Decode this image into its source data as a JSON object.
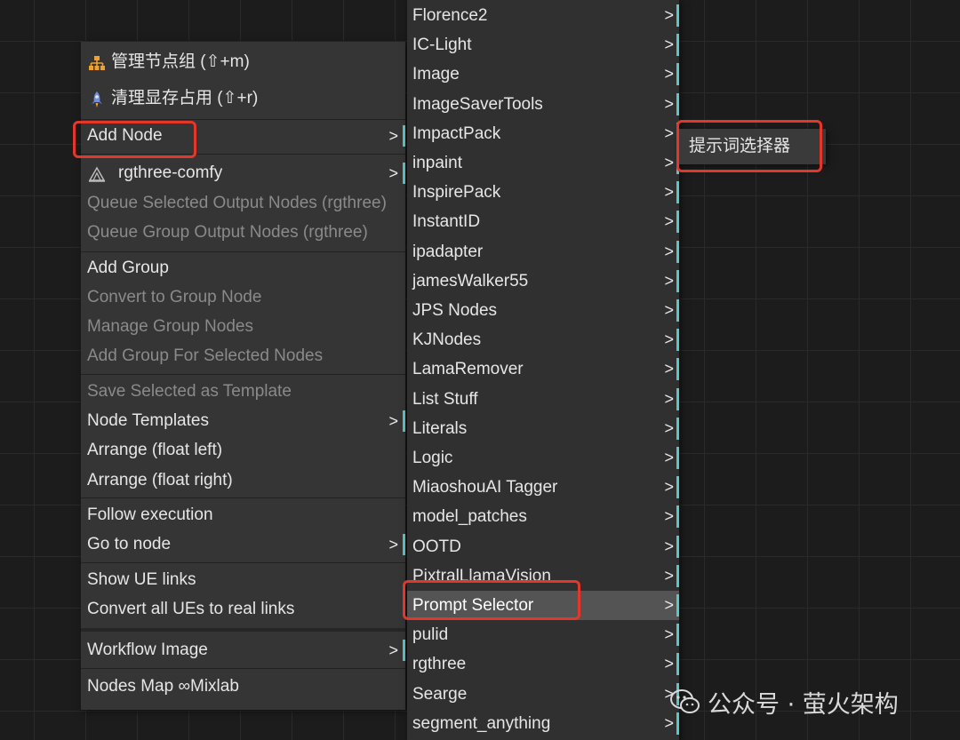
{
  "main_menu": {
    "manage_groups": "管理节点组 (⇧+m)",
    "clear_cache": "清理显存占用 (⇧+r)",
    "add_node": "Add Node",
    "add_node_arrow": ">",
    "rgthree_comfy": "rgthree-comfy",
    "rgthree_arrow": ">",
    "queue_selected": "Queue Selected Output Nodes (rgthree)",
    "queue_group": "Queue Group Output Nodes (rgthree)",
    "add_group": "Add Group",
    "convert_group": "Convert to Group Node",
    "manage_group_nodes": "Manage Group Nodes",
    "add_group_selected": "Add Group For Selected Nodes",
    "save_template": "Save Selected as Template",
    "node_templates": "Node Templates",
    "node_templates_arrow": ">",
    "arrange_left": "Arrange (float left)",
    "arrange_right": "Arrange (float right)",
    "follow_execution": "Follow execution",
    "go_to_node": "Go to node",
    "go_to_node_arrow": ">",
    "show_ue_links": "Show UE links",
    "convert_ue_links": "Convert all UEs to real links",
    "workflow_image": "Workflow Image",
    "workflow_image_arrow": ">",
    "nodes_map": "Nodes Map ∞Mixlab"
  },
  "sub_menu": {
    "arrow": ">",
    "items": [
      "Florence2",
      "IC-Light",
      "Image",
      "ImageSaverTools",
      "ImpactPack",
      "inpaint",
      "InspirePack",
      "InstantID",
      "ipadapter",
      "jamesWalker55",
      "JPS Nodes",
      "KJNodes",
      "LamaRemover",
      "List Stuff",
      "Literals",
      "Logic",
      "MiaoshouAI Tagger",
      "model_patches",
      "OOTD",
      "PixtralLlamaVision",
      "Prompt Selector",
      "pulid",
      "rgthree",
      "Searge",
      "segment_anything"
    ],
    "active_item": "Prompt Selector"
  },
  "deep_menu": {
    "item": "提示词选择器"
  },
  "watermark": {
    "text": "公众号 · 萤火架构"
  },
  "colors": {
    "highlight": "#e4372a",
    "accent_bar": "#5ac7c7",
    "menu_bg": "#353535",
    "disabled_text": "#8a8a8a"
  },
  "icons": {
    "manage_groups": "hierarchy-icon",
    "clear_cache": "rocket-icon",
    "rgthree": "rgthree-logo-icon",
    "watermark": "wechat-icon"
  }
}
